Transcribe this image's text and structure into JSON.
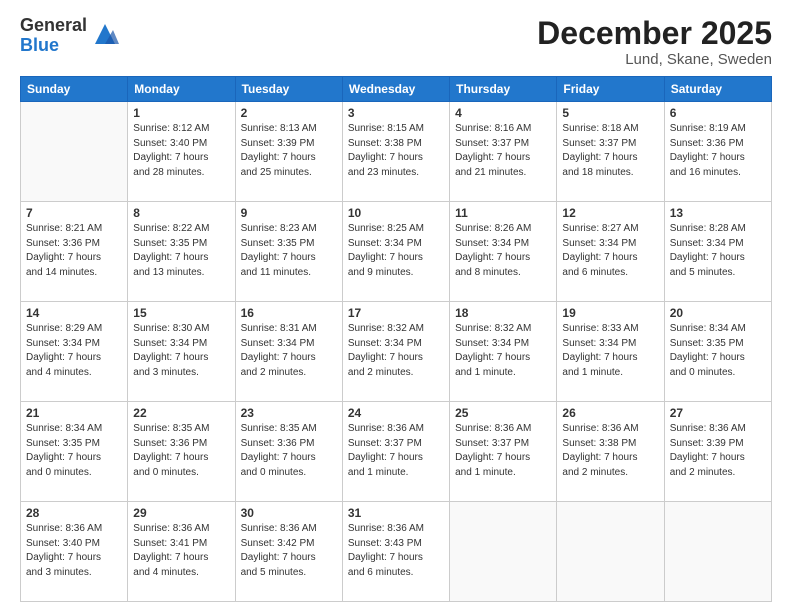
{
  "logo": {
    "general": "General",
    "blue": "Blue"
  },
  "header": {
    "month": "December 2025",
    "location": "Lund, Skane, Sweden"
  },
  "weekdays": [
    "Sunday",
    "Monday",
    "Tuesday",
    "Wednesday",
    "Thursday",
    "Friday",
    "Saturday"
  ],
  "weeks": [
    [
      {
        "day": "",
        "info": ""
      },
      {
        "day": "1",
        "info": "Sunrise: 8:12 AM\nSunset: 3:40 PM\nDaylight: 7 hours\nand 28 minutes."
      },
      {
        "day": "2",
        "info": "Sunrise: 8:13 AM\nSunset: 3:39 PM\nDaylight: 7 hours\nand 25 minutes."
      },
      {
        "day": "3",
        "info": "Sunrise: 8:15 AM\nSunset: 3:38 PM\nDaylight: 7 hours\nand 23 minutes."
      },
      {
        "day": "4",
        "info": "Sunrise: 8:16 AM\nSunset: 3:37 PM\nDaylight: 7 hours\nand 21 minutes."
      },
      {
        "day": "5",
        "info": "Sunrise: 8:18 AM\nSunset: 3:37 PM\nDaylight: 7 hours\nand 18 minutes."
      },
      {
        "day": "6",
        "info": "Sunrise: 8:19 AM\nSunset: 3:36 PM\nDaylight: 7 hours\nand 16 minutes."
      }
    ],
    [
      {
        "day": "7",
        "info": "Sunrise: 8:21 AM\nSunset: 3:36 PM\nDaylight: 7 hours\nand 14 minutes."
      },
      {
        "day": "8",
        "info": "Sunrise: 8:22 AM\nSunset: 3:35 PM\nDaylight: 7 hours\nand 13 minutes."
      },
      {
        "day": "9",
        "info": "Sunrise: 8:23 AM\nSunset: 3:35 PM\nDaylight: 7 hours\nand 11 minutes."
      },
      {
        "day": "10",
        "info": "Sunrise: 8:25 AM\nSunset: 3:34 PM\nDaylight: 7 hours\nand 9 minutes."
      },
      {
        "day": "11",
        "info": "Sunrise: 8:26 AM\nSunset: 3:34 PM\nDaylight: 7 hours\nand 8 minutes."
      },
      {
        "day": "12",
        "info": "Sunrise: 8:27 AM\nSunset: 3:34 PM\nDaylight: 7 hours\nand 6 minutes."
      },
      {
        "day": "13",
        "info": "Sunrise: 8:28 AM\nSunset: 3:34 PM\nDaylight: 7 hours\nand 5 minutes."
      }
    ],
    [
      {
        "day": "14",
        "info": "Sunrise: 8:29 AM\nSunset: 3:34 PM\nDaylight: 7 hours\nand 4 minutes."
      },
      {
        "day": "15",
        "info": "Sunrise: 8:30 AM\nSunset: 3:34 PM\nDaylight: 7 hours\nand 3 minutes."
      },
      {
        "day": "16",
        "info": "Sunrise: 8:31 AM\nSunset: 3:34 PM\nDaylight: 7 hours\nand 2 minutes."
      },
      {
        "day": "17",
        "info": "Sunrise: 8:32 AM\nSunset: 3:34 PM\nDaylight: 7 hours\nand 2 minutes."
      },
      {
        "day": "18",
        "info": "Sunrise: 8:32 AM\nSunset: 3:34 PM\nDaylight: 7 hours\nand 1 minute."
      },
      {
        "day": "19",
        "info": "Sunrise: 8:33 AM\nSunset: 3:34 PM\nDaylight: 7 hours\nand 1 minute."
      },
      {
        "day": "20",
        "info": "Sunrise: 8:34 AM\nSunset: 3:35 PM\nDaylight: 7 hours\nand 0 minutes."
      }
    ],
    [
      {
        "day": "21",
        "info": "Sunrise: 8:34 AM\nSunset: 3:35 PM\nDaylight: 7 hours\nand 0 minutes."
      },
      {
        "day": "22",
        "info": "Sunrise: 8:35 AM\nSunset: 3:36 PM\nDaylight: 7 hours\nand 0 minutes."
      },
      {
        "day": "23",
        "info": "Sunrise: 8:35 AM\nSunset: 3:36 PM\nDaylight: 7 hours\nand 0 minutes."
      },
      {
        "day": "24",
        "info": "Sunrise: 8:36 AM\nSunset: 3:37 PM\nDaylight: 7 hours\nand 1 minute."
      },
      {
        "day": "25",
        "info": "Sunrise: 8:36 AM\nSunset: 3:37 PM\nDaylight: 7 hours\nand 1 minute."
      },
      {
        "day": "26",
        "info": "Sunrise: 8:36 AM\nSunset: 3:38 PM\nDaylight: 7 hours\nand 2 minutes."
      },
      {
        "day": "27",
        "info": "Sunrise: 8:36 AM\nSunset: 3:39 PM\nDaylight: 7 hours\nand 2 minutes."
      }
    ],
    [
      {
        "day": "28",
        "info": "Sunrise: 8:36 AM\nSunset: 3:40 PM\nDaylight: 7 hours\nand 3 minutes."
      },
      {
        "day": "29",
        "info": "Sunrise: 8:36 AM\nSunset: 3:41 PM\nDaylight: 7 hours\nand 4 minutes."
      },
      {
        "day": "30",
        "info": "Sunrise: 8:36 AM\nSunset: 3:42 PM\nDaylight: 7 hours\nand 5 minutes."
      },
      {
        "day": "31",
        "info": "Sunrise: 8:36 AM\nSunset: 3:43 PM\nDaylight: 7 hours\nand 6 minutes."
      },
      {
        "day": "",
        "info": ""
      },
      {
        "day": "",
        "info": ""
      },
      {
        "day": "",
        "info": ""
      }
    ]
  ]
}
